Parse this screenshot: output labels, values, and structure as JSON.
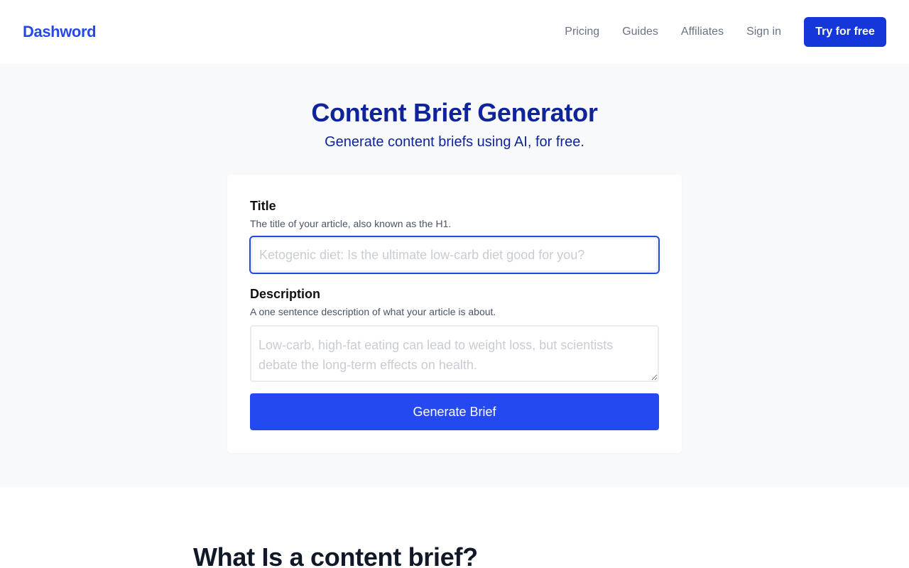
{
  "header": {
    "logo": "Dashword",
    "nav": [
      {
        "label": "Pricing"
      },
      {
        "label": "Guides"
      },
      {
        "label": "Affiliates"
      },
      {
        "label": "Sign in"
      }
    ],
    "cta_label": "Try for free"
  },
  "hero": {
    "title": "Content Brief Generator",
    "subtitle": "Generate content briefs using AI, for free."
  },
  "form": {
    "title_label": "Title",
    "title_help": "The title of your article, also known as the H1.",
    "title_value": "",
    "title_placeholder": "Ketogenic diet: Is the ultimate low-carb diet good for you?",
    "description_label": "Description",
    "description_help": "A one sentence description of what your article is about.",
    "description_value": "",
    "description_placeholder": "Low-carb, high-fat eating can lead to weight loss, but scientists debate the long-term effects on health.",
    "submit_label": "Generate Brief"
  },
  "section": {
    "heading": "What Is a content brief?"
  },
  "colors": {
    "brand": "#2549e8",
    "cta": "#1536d9",
    "hero_text": "#10249a",
    "button": "#2549f0",
    "hero_bg": "#f8f9fb"
  }
}
